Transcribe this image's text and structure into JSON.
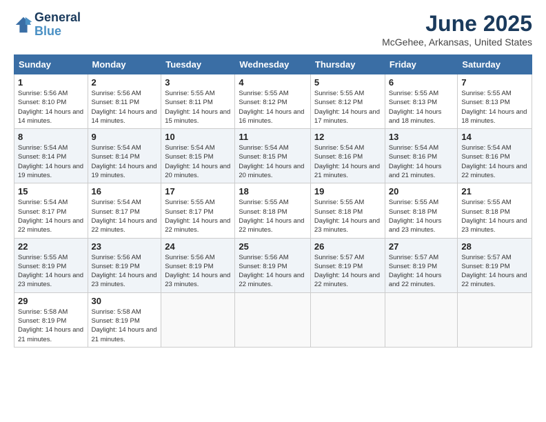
{
  "logo": {
    "line1": "General",
    "line2": "Blue"
  },
  "title": "June 2025",
  "location": "McGehee, Arkansas, United States",
  "weekdays": [
    "Sunday",
    "Monday",
    "Tuesday",
    "Wednesday",
    "Thursday",
    "Friday",
    "Saturday"
  ],
  "weeks": [
    [
      {
        "day": "1",
        "sunrise": "5:56 AM",
        "sunset": "8:10 PM",
        "daylight": "14 hours and 14 minutes."
      },
      {
        "day": "2",
        "sunrise": "5:56 AM",
        "sunset": "8:11 PM",
        "daylight": "14 hours and 14 minutes."
      },
      {
        "day": "3",
        "sunrise": "5:55 AM",
        "sunset": "8:11 PM",
        "daylight": "14 hours and 15 minutes."
      },
      {
        "day": "4",
        "sunrise": "5:55 AM",
        "sunset": "8:12 PM",
        "daylight": "14 hours and 16 minutes."
      },
      {
        "day": "5",
        "sunrise": "5:55 AM",
        "sunset": "8:12 PM",
        "daylight": "14 hours and 17 minutes."
      },
      {
        "day": "6",
        "sunrise": "5:55 AM",
        "sunset": "8:13 PM",
        "daylight": "14 hours and 18 minutes."
      },
      {
        "day": "7",
        "sunrise": "5:55 AM",
        "sunset": "8:13 PM",
        "daylight": "14 hours and 18 minutes."
      }
    ],
    [
      {
        "day": "8",
        "sunrise": "5:54 AM",
        "sunset": "8:14 PM",
        "daylight": "14 hours and 19 minutes."
      },
      {
        "day": "9",
        "sunrise": "5:54 AM",
        "sunset": "8:14 PM",
        "daylight": "14 hours and 19 minutes."
      },
      {
        "day": "10",
        "sunrise": "5:54 AM",
        "sunset": "8:15 PM",
        "daylight": "14 hours and 20 minutes."
      },
      {
        "day": "11",
        "sunrise": "5:54 AM",
        "sunset": "8:15 PM",
        "daylight": "14 hours and 20 minutes."
      },
      {
        "day": "12",
        "sunrise": "5:54 AM",
        "sunset": "8:16 PM",
        "daylight": "14 hours and 21 minutes."
      },
      {
        "day": "13",
        "sunrise": "5:54 AM",
        "sunset": "8:16 PM",
        "daylight": "14 hours and 21 minutes."
      },
      {
        "day": "14",
        "sunrise": "5:54 AM",
        "sunset": "8:16 PM",
        "daylight": "14 hours and 22 minutes."
      }
    ],
    [
      {
        "day": "15",
        "sunrise": "5:54 AM",
        "sunset": "8:17 PM",
        "daylight": "14 hours and 22 minutes."
      },
      {
        "day": "16",
        "sunrise": "5:54 AM",
        "sunset": "8:17 PM",
        "daylight": "14 hours and 22 minutes."
      },
      {
        "day": "17",
        "sunrise": "5:55 AM",
        "sunset": "8:17 PM",
        "daylight": "14 hours and 22 minutes."
      },
      {
        "day": "18",
        "sunrise": "5:55 AM",
        "sunset": "8:18 PM",
        "daylight": "14 hours and 22 minutes."
      },
      {
        "day": "19",
        "sunrise": "5:55 AM",
        "sunset": "8:18 PM",
        "daylight": "14 hours and 23 minutes."
      },
      {
        "day": "20",
        "sunrise": "5:55 AM",
        "sunset": "8:18 PM",
        "daylight": "14 hours and 23 minutes."
      },
      {
        "day": "21",
        "sunrise": "5:55 AM",
        "sunset": "8:18 PM",
        "daylight": "14 hours and 23 minutes."
      }
    ],
    [
      {
        "day": "22",
        "sunrise": "5:55 AM",
        "sunset": "8:19 PM",
        "daylight": "14 hours and 23 minutes."
      },
      {
        "day": "23",
        "sunrise": "5:56 AM",
        "sunset": "8:19 PM",
        "daylight": "14 hours and 23 minutes."
      },
      {
        "day": "24",
        "sunrise": "5:56 AM",
        "sunset": "8:19 PM",
        "daylight": "14 hours and 23 minutes."
      },
      {
        "day": "25",
        "sunrise": "5:56 AM",
        "sunset": "8:19 PM",
        "daylight": "14 hours and 22 minutes."
      },
      {
        "day": "26",
        "sunrise": "5:57 AM",
        "sunset": "8:19 PM",
        "daylight": "14 hours and 22 minutes."
      },
      {
        "day": "27",
        "sunrise": "5:57 AM",
        "sunset": "8:19 PM",
        "daylight": "14 hours and 22 minutes."
      },
      {
        "day": "28",
        "sunrise": "5:57 AM",
        "sunset": "8:19 PM",
        "daylight": "14 hours and 22 minutes."
      }
    ],
    [
      {
        "day": "29",
        "sunrise": "5:58 AM",
        "sunset": "8:19 PM",
        "daylight": "14 hours and 21 minutes."
      },
      {
        "day": "30",
        "sunrise": "5:58 AM",
        "sunset": "8:19 PM",
        "daylight": "14 hours and 21 minutes."
      },
      null,
      null,
      null,
      null,
      null
    ]
  ]
}
